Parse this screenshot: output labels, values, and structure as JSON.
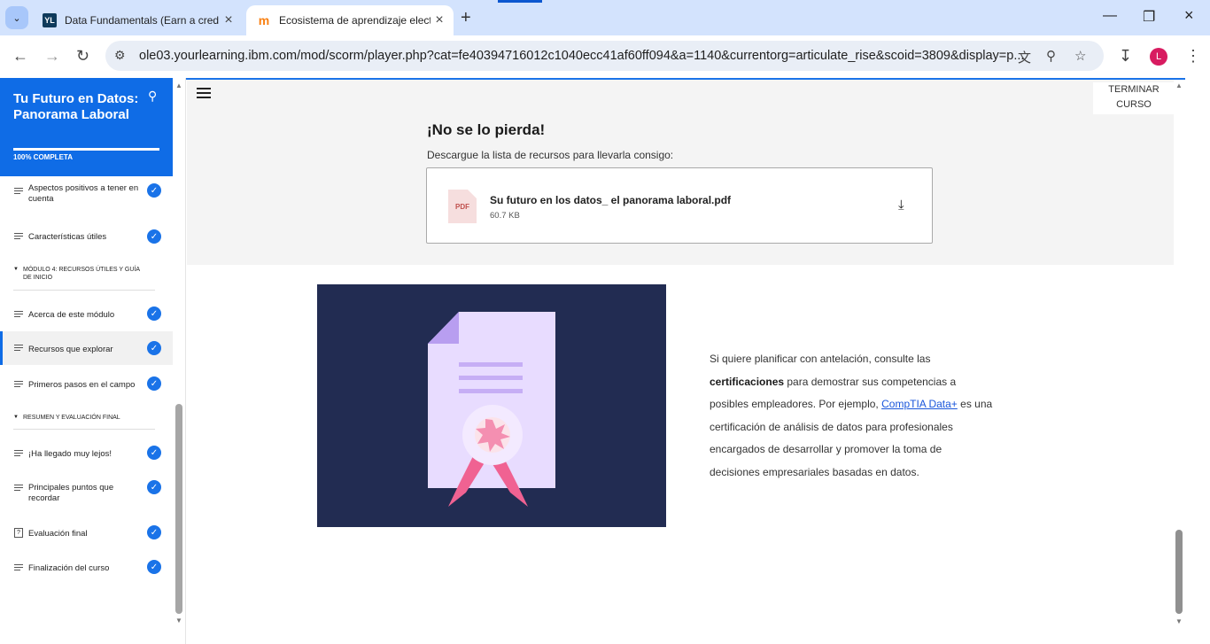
{
  "browser": {
    "tabs": [
      {
        "title": "Data Fundamentals (Earn a cred",
        "favicon": "YL"
      },
      {
        "title": "Ecosistema de aprendizaje elect",
        "favicon": "m"
      }
    ],
    "url": "ole03.yourlearning.ibm.com/mod/scorm/player.php?cat=fe40394716012c1040ecc41af60ff094&a=1140&currentorg=articulate_rise&scoid=3809&display=p...",
    "avatar_letter": "L"
  },
  "sidebar": {
    "course_title": "Tu Futuro en Datos: Panorama Laboral",
    "progress_label": "100% COMPLETA",
    "progress_fraction": 1.0,
    "items": [
      {
        "label": "Aspectos positivos a tener en cuenta"
      },
      {
        "label": "Características útiles"
      },
      {
        "label": "Acerca de este módulo"
      },
      {
        "label": "Recursos que explorar"
      },
      {
        "label": "Primeros pasos en el campo"
      },
      {
        "label": "¡Ha llegado muy lejos!"
      },
      {
        "label": "Principales puntos que recordar"
      },
      {
        "label": "Evaluación final"
      },
      {
        "label": "Finalización del curso"
      }
    ],
    "sections": [
      {
        "label": "MÓDULO 4: RECURSOS ÚTILES Y GUÍA DE INICIO"
      },
      {
        "label": "RESUMEN Y EVALUACIÓN FINAL"
      }
    ]
  },
  "main": {
    "end_course_label_line1": "TERMINAR",
    "end_course_label_line2": "CURSO",
    "heading": "¡No se lo pierda!",
    "subtitle": "Descargue la lista de recursos para llevarla consigo:",
    "file": {
      "badge": "PDF",
      "name": "Su futuro en los datos_ el panorama laboral.pdf",
      "size": "60.7 KB"
    },
    "body": {
      "part1": "Si quiere planificar con antelación, consulte las ",
      "bold": "certificaciones",
      "part2": " para demostrar sus competencias a posibles empleadores. Por ejemplo, ",
      "link": "CompTIA Data+",
      "part3": " es una certificación de análisis de datos para profesionales encargados de desarrollar y promover la toma de decisiones empresariales basadas en datos."
    }
  },
  "colors": {
    "accent": "#0f6ce6",
    "illustration_bg": "#222c52",
    "check": "#1a73e8"
  }
}
